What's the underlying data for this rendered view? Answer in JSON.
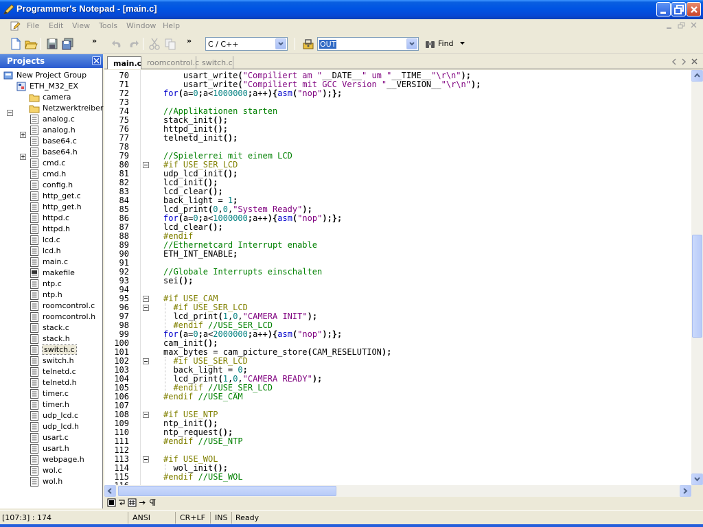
{
  "window": {
    "title": "Programmer's Notepad - [main.c]",
    "colors": {
      "titlebar": "#0054e3",
      "panel_header": "#2a5bd0"
    }
  },
  "menu": [
    "File",
    "Edit",
    "View",
    "Tools",
    "Window",
    "Help"
  ],
  "toolbar": {
    "scheme_select": "C / C++",
    "search_value": "OUT",
    "find_label": "Find",
    "overflow_glyph": "»"
  },
  "projects": {
    "title": "Projects",
    "group": "New Project Group",
    "project": "ETH_M32_EX",
    "folders": [
      "camera",
      "Netzwerktreiber"
    ],
    "files": [
      "analog.c",
      "analog.h",
      "base64.c",
      "base64.h",
      "cmd.c",
      "cmd.h",
      "config.h",
      "http_get.c",
      "http_get.h",
      "httpd.c",
      "httpd.h",
      "lcd.c",
      "lcd.h",
      "main.c",
      "makefile",
      "ntp.c",
      "ntp.h",
      "roomcontrol.c",
      "roomcontrol.h",
      "stack.c",
      "stack.h",
      "switch.c",
      "switch.h",
      "telnetd.c",
      "telnetd.h",
      "timer.c",
      "timer.h",
      "udp_lcd.c",
      "udp_lcd.h",
      "usart.c",
      "usart.h",
      "webpage.h",
      "wol.c",
      "wol.h"
    ],
    "selected_file": "switch.c"
  },
  "tabs": [
    "main.c",
    "roomcontrol.c",
    "switch.c"
  ],
  "editor": {
    "lines": [
      {
        "n": "70",
        "t": "    usart_write(\"Compiliert am \"__DATE__\" um \"__TIME__\"\\r\\n\");"
      },
      {
        "n": "71",
        "t": "    usart_write(\"Compiliert mit GCC Version \"__VERSION__\"\\r\\n\");"
      },
      {
        "n": "72",
        "t": "for(a=0;a<1000000;a++){asm(\"nop\");};"
      },
      {
        "n": "73",
        "t": ""
      },
      {
        "n": "74",
        "t": "//Applikationen starten"
      },
      {
        "n": "75",
        "t": "stack_init();"
      },
      {
        "n": "76",
        "t": "httpd_init();"
      },
      {
        "n": "77",
        "t": "telnetd_init();"
      },
      {
        "n": "78",
        "t": ""
      },
      {
        "n": "79",
        "t": "//Spielerrei mit einem LCD"
      },
      {
        "n": "80",
        "t": "#if USE_SER_LCD"
      },
      {
        "n": "81",
        "t": "udp_lcd_init();"
      },
      {
        "n": "82",
        "t": "lcd_init();"
      },
      {
        "n": "83",
        "t": "lcd_clear();"
      },
      {
        "n": "84",
        "t": "back_light = 1;"
      },
      {
        "n": "85",
        "t": "lcd_print(0,0,\"System Ready\");"
      },
      {
        "n": "86",
        "t": "for(a=0;a<1000000;a++){asm(\"nop\");};"
      },
      {
        "n": "87",
        "t": "lcd_clear();"
      },
      {
        "n": "88",
        "t": "#endif"
      },
      {
        "n": "89",
        "t": "//Ethernetcard Interrupt enable"
      },
      {
        "n": "90",
        "t": "ETH_INT_ENABLE;"
      },
      {
        "n": "91",
        "t": ""
      },
      {
        "n": "92",
        "t": "//Globale Interrupts einschalten"
      },
      {
        "n": "93",
        "t": "sei();"
      },
      {
        "n": "94",
        "t": ""
      },
      {
        "n": "95",
        "t": "#if USE_CAM"
      },
      {
        "n": "96",
        "t": "  #if USE_SER_LCD"
      },
      {
        "n": "97",
        "t": "  lcd_print(1,0,\"CAMERA INIT\");"
      },
      {
        "n": "98",
        "t": "  #endif //USE_SER_LCD"
      },
      {
        "n": "99",
        "t": "for(a=0;a<2000000;a++){asm(\"nop\");};"
      },
      {
        "n": "100",
        "t": "cam_init();"
      },
      {
        "n": "101",
        "t": "max_bytes = cam_picture_store(CAM_RESELUTION);"
      },
      {
        "n": "102",
        "t": "  #if USE_SER_LCD"
      },
      {
        "n": "103",
        "t": "  back_light = 0;"
      },
      {
        "n": "104",
        "t": "  lcd_print(1,0,\"CAMERA READY\");"
      },
      {
        "n": "105",
        "t": "  #endif //USE_SER_LCD"
      },
      {
        "n": "106",
        "t": "#endif //USE_CAM"
      },
      {
        "n": "107",
        "t": ""
      },
      {
        "n": "108",
        "t": "#if USE_NTP"
      },
      {
        "n": "109",
        "t": "ntp_init();"
      },
      {
        "n": "110",
        "t": "ntp_request();"
      },
      {
        "n": "111",
        "t": "#endif //USE_NTP"
      },
      {
        "n": "112",
        "t": ""
      },
      {
        "n": "113",
        "t": "#if USE_WOL"
      },
      {
        "n": "114",
        "t": "  wol_init();"
      },
      {
        "n": "115",
        "t": "#endif //USE_WOL"
      },
      {
        "n": "116",
        "t": ""
      }
    ],
    "fold_lines": [
      "80",
      "95",
      "96",
      "102",
      "108",
      "113"
    ]
  },
  "status": {
    "position": "[107:3] : 174",
    "encoding": "ANSI",
    "line_endings": "CR+LF",
    "mode": "INS",
    "state": "Ready"
  }
}
